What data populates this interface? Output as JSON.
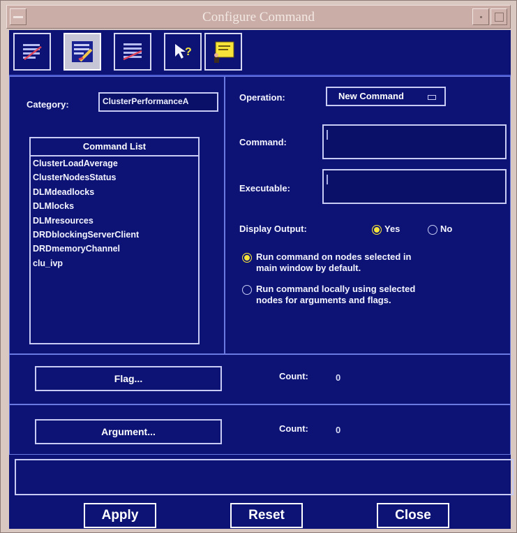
{
  "window": {
    "title": "Configure Command"
  },
  "toolbar": {
    "buttons": [
      {
        "icon": "list-edit-icon"
      },
      {
        "icon": "list-pencil-icon"
      },
      {
        "icon": "list-check-icon"
      },
      {
        "icon": "pointer-help-icon"
      },
      {
        "icon": "presenter-board-icon"
      }
    ]
  },
  "left": {
    "category_label": "Category:",
    "category_value": "ClusterPerformanceA",
    "list_header": "Command List",
    "commands": [
      "ClusterLoadAverage",
      "ClusterNodesStatus",
      "DLMdeadlocks",
      "DLMlocks",
      "DLMresources",
      "DRDblockingServerClient",
      "DRDmemoryChannel",
      "clu_ivp"
    ]
  },
  "right": {
    "operation_label": "Operation:",
    "operation_value": "New Command",
    "command_label": "Command:",
    "command_value": "",
    "executable_label": "Executable:",
    "executable_value": "",
    "display_output_label": "Display Output:",
    "yes_label": "Yes",
    "no_label": "No",
    "run_nodes_line1": "Run command on nodes selected in",
    "run_nodes_line2": "main window by default.",
    "run_local_line1": "Run command locally using selected",
    "run_local_line2": "nodes for arguments and flags."
  },
  "flag": {
    "button": "Flag...",
    "count_label": "Count:",
    "count_value": "0"
  },
  "argument": {
    "button": "Argument...",
    "count_label": "Count:",
    "count_value": "0"
  },
  "status_text": "",
  "bottom": {
    "apply": "Apply",
    "reset": "Reset",
    "close": "Close"
  },
  "colors": {
    "background": "#0c1374",
    "accent": "#f6e43a",
    "titlebar": "#c9ada6"
  }
}
